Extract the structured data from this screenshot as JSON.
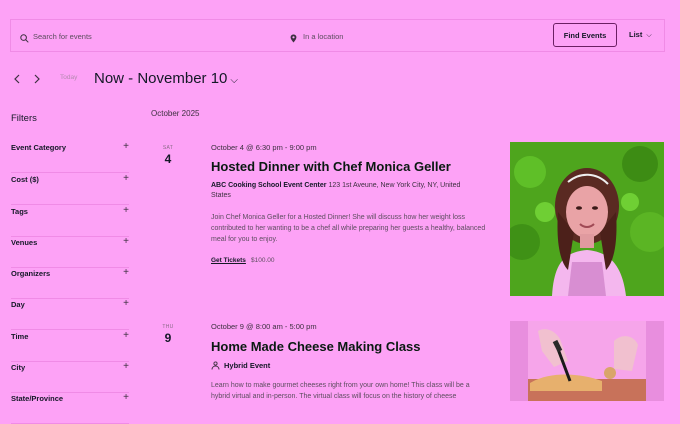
{
  "search": {
    "keyword_placeholder": "Search for events",
    "location_placeholder": "In a location",
    "find_button": "Find Events",
    "view_label": "List"
  },
  "nav": {
    "today_label": "Today",
    "date_title": "Now - November 10"
  },
  "filters": {
    "heading": "Filters",
    "items": [
      {
        "label": "Event Category"
      },
      {
        "label": "Cost ($)"
      },
      {
        "label": "Tags"
      },
      {
        "label": "Venues"
      },
      {
        "label": "Organizers"
      },
      {
        "label": "Day"
      },
      {
        "label": "Time"
      },
      {
        "label": "City"
      },
      {
        "label": "State/Province"
      }
    ]
  },
  "events": {
    "month": "October 2025",
    "items": [
      {
        "day_name": "SAT",
        "day_num": "4",
        "time": "October 4 @ 6:30 pm - 9:00 pm",
        "title": "Hosted Dinner with Chef Monica Geller",
        "venue_name": "ABC Cooking School Event Center",
        "venue_address": "123 1st Aveune, New York City, NY, United States",
        "description": "Join Chef Monica Geller for a Hosted Dinner! She will discuss how her weight loss contributed to her wanting to be a chef all while preparing her guests a healthy, balanced meal for you to enjoy.",
        "ticket_label": "Get Tickets",
        "price": "$100.00"
      },
      {
        "day_name": "THU",
        "day_num": "9",
        "time": "October 9 @ 8:00 am - 5:00 pm",
        "title": "Home Made Cheese Making Class",
        "venue_label": "Hybrid Event",
        "description": "Learn how to make gourmet cheeses right from your own home! This class will be a hybrid virtual and in-person. The virtual class will focus on the history of cheese"
      }
    ]
  },
  "icons": {
    "search": "search-icon",
    "location": "map-pin-icon",
    "prev": "chevron-left-icon",
    "next": "chevron-right-icon",
    "hybrid": "hybrid-event-icon",
    "expand": "plus-icon"
  },
  "colors": {
    "background": "#fda2f6",
    "text": "#141827",
    "border": "#f08be6",
    "title_text": "#0a1a12",
    "button_border": "#6b1f63"
  }
}
